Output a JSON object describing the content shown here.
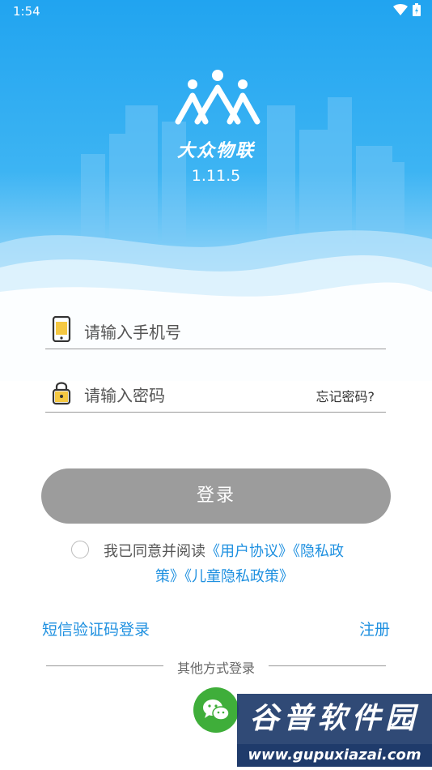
{
  "status_bar": {
    "time": "1:54",
    "wifi_icon": "wifi-icon",
    "battery_icon": "battery-icon"
  },
  "brand": {
    "name": "大众物联",
    "version": "1.11.5",
    "logo_icon": "people-logo-icon"
  },
  "form": {
    "phone_placeholder": "请输入手机号",
    "phone_icon": "phone-icon",
    "password_placeholder": "请输入密码",
    "password_icon": "lock-icon",
    "forgot_label": "忘记密码?"
  },
  "login_button": {
    "label": "登录"
  },
  "agreement": {
    "prefix": "我已同意并阅读",
    "user_agreement": "《用户协议》",
    "privacy_part1": "《隐私政",
    "privacy_part2": "策》",
    "child_privacy": "《儿童隐私政策》"
  },
  "links": {
    "sms_login": "短信验证码登录",
    "register": "注册"
  },
  "other_login": {
    "label": "其他方式登录",
    "wechat_icon": "wechat-icon"
  },
  "watermark": {
    "title": "谷普软件园",
    "url": "www.gupuxiazai.com"
  },
  "colors": {
    "accent": "#1e90e0",
    "hero_blue": "#21a4f0",
    "button_gray": "#9c9c9c",
    "wechat_green": "#3fae3a"
  }
}
